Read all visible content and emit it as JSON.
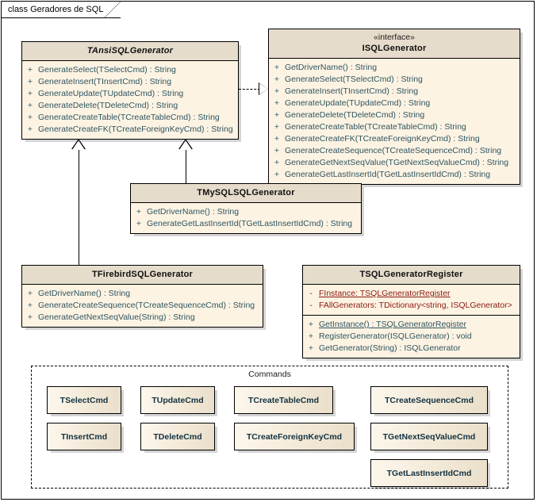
{
  "frame": {
    "tab_label": "class Geradores de SQL"
  },
  "classes": {
    "ansi": {
      "name": "TAnsiSQLGenerator",
      "operations": [
        {
          "visibility": "+",
          "signature": "GenerateSelect(TSelectCmd) : String"
        },
        {
          "visibility": "+",
          "signature": "GenerateInsert(TInsertCmd) : String"
        },
        {
          "visibility": "+",
          "signature": "GenerateUpdate(TUpdateCmd) : String"
        },
        {
          "visibility": "+",
          "signature": "GenerateDelete(TDeleteCmd) : String"
        },
        {
          "visibility": "+",
          "signature": "GenerateCreateTable(TCreateTableCmd) : String"
        },
        {
          "visibility": "+",
          "signature": "GenerateCreateFK(TCreateForeignKeyCmd) : String"
        }
      ]
    },
    "isql": {
      "stereotype": "«interface»",
      "name": "ISQLGenerator",
      "operations": [
        {
          "visibility": "+",
          "signature": "GetDriverName() : String"
        },
        {
          "visibility": "+",
          "signature": "GenerateSelect(TSelectCmd) : String"
        },
        {
          "visibility": "+",
          "signature": "GenerateInsert(TInsertCmd) : String"
        },
        {
          "visibility": "+",
          "signature": "GenerateUpdate(TUpdateCmd) : String"
        },
        {
          "visibility": "+",
          "signature": "GenerateDelete(TDeleteCmd) : String"
        },
        {
          "visibility": "+",
          "signature": "GenerateCreateTable(TCreateTableCmd) : String"
        },
        {
          "visibility": "+",
          "signature": "GenerateCreateFK(TCreateForeignKeyCmd) : String"
        },
        {
          "visibility": "+",
          "signature": "GenerateCreateSequence(TCreateSequenceCmd) : String"
        },
        {
          "visibility": "+",
          "signature": "GenerateGetNextSeqValue(TGetNextSeqValueCmd) : String"
        },
        {
          "visibility": "+",
          "signature": "GenerateGetLastInsertId(TGetLastInsertIdCmd) : String"
        }
      ]
    },
    "mysql": {
      "name": "TMySQLSQLGenerator",
      "operations": [
        {
          "visibility": "+",
          "signature": "GetDriverName() : String"
        },
        {
          "visibility": "+",
          "signature": "GenerateGetLastInsertId(TGetLastInsertIdCmd) : String"
        }
      ]
    },
    "firebird": {
      "name": "TFirebirdSQLGenerator",
      "operations": [
        {
          "visibility": "+",
          "signature": "GetDriverName() : String"
        },
        {
          "visibility": "+",
          "signature": "GenerateCreateSequence(TCreateSequenceCmd) : String"
        },
        {
          "visibility": "+",
          "signature": "GenerateGetNextSeqValue(String) : String"
        }
      ]
    },
    "register": {
      "name": "TSQLGeneratorRegister",
      "attributes": [
        {
          "visibility": "-",
          "signature": "FInstance:  TSQLGeneratorRegister",
          "static": true
        },
        {
          "visibility": "-",
          "signature": "FAllGenerators:  TDictionary<string, ISQLGenerator>",
          "static": false
        }
      ],
      "operations": [
        {
          "visibility": "+",
          "signature": "GetInstance() : TSQLGeneratorRegister",
          "static": true
        },
        {
          "visibility": "+",
          "signature": "RegisterGenerator(ISQLGenerator) : void",
          "static": false
        },
        {
          "visibility": "+",
          "signature": "GetGenerator(String) : ISQLGenerator",
          "static": false
        }
      ]
    }
  },
  "commands_package": {
    "label": "Commands",
    "boxes": [
      {
        "name": "TSelectCmd"
      },
      {
        "name": "TUpdateCmd"
      },
      {
        "name": "TCreateTableCmd"
      },
      {
        "name": "TCreateSequenceCmd"
      },
      {
        "name": "TInsertCmd"
      },
      {
        "name": "TDeleteCmd"
      },
      {
        "name": "TCreateForeignKeyCmd"
      },
      {
        "name": "TGetNextSeqValueCmd"
      },
      {
        "name": "TGetLastInsertIdCmd"
      }
    ]
  },
  "colors": {
    "header_fill": "#e6dccb",
    "body_fill": "#fdf3e3",
    "border": "#000000",
    "operation_text": "#2d5560",
    "attribute_text": "#8b1a12",
    "command_title_text": "#123241"
  }
}
